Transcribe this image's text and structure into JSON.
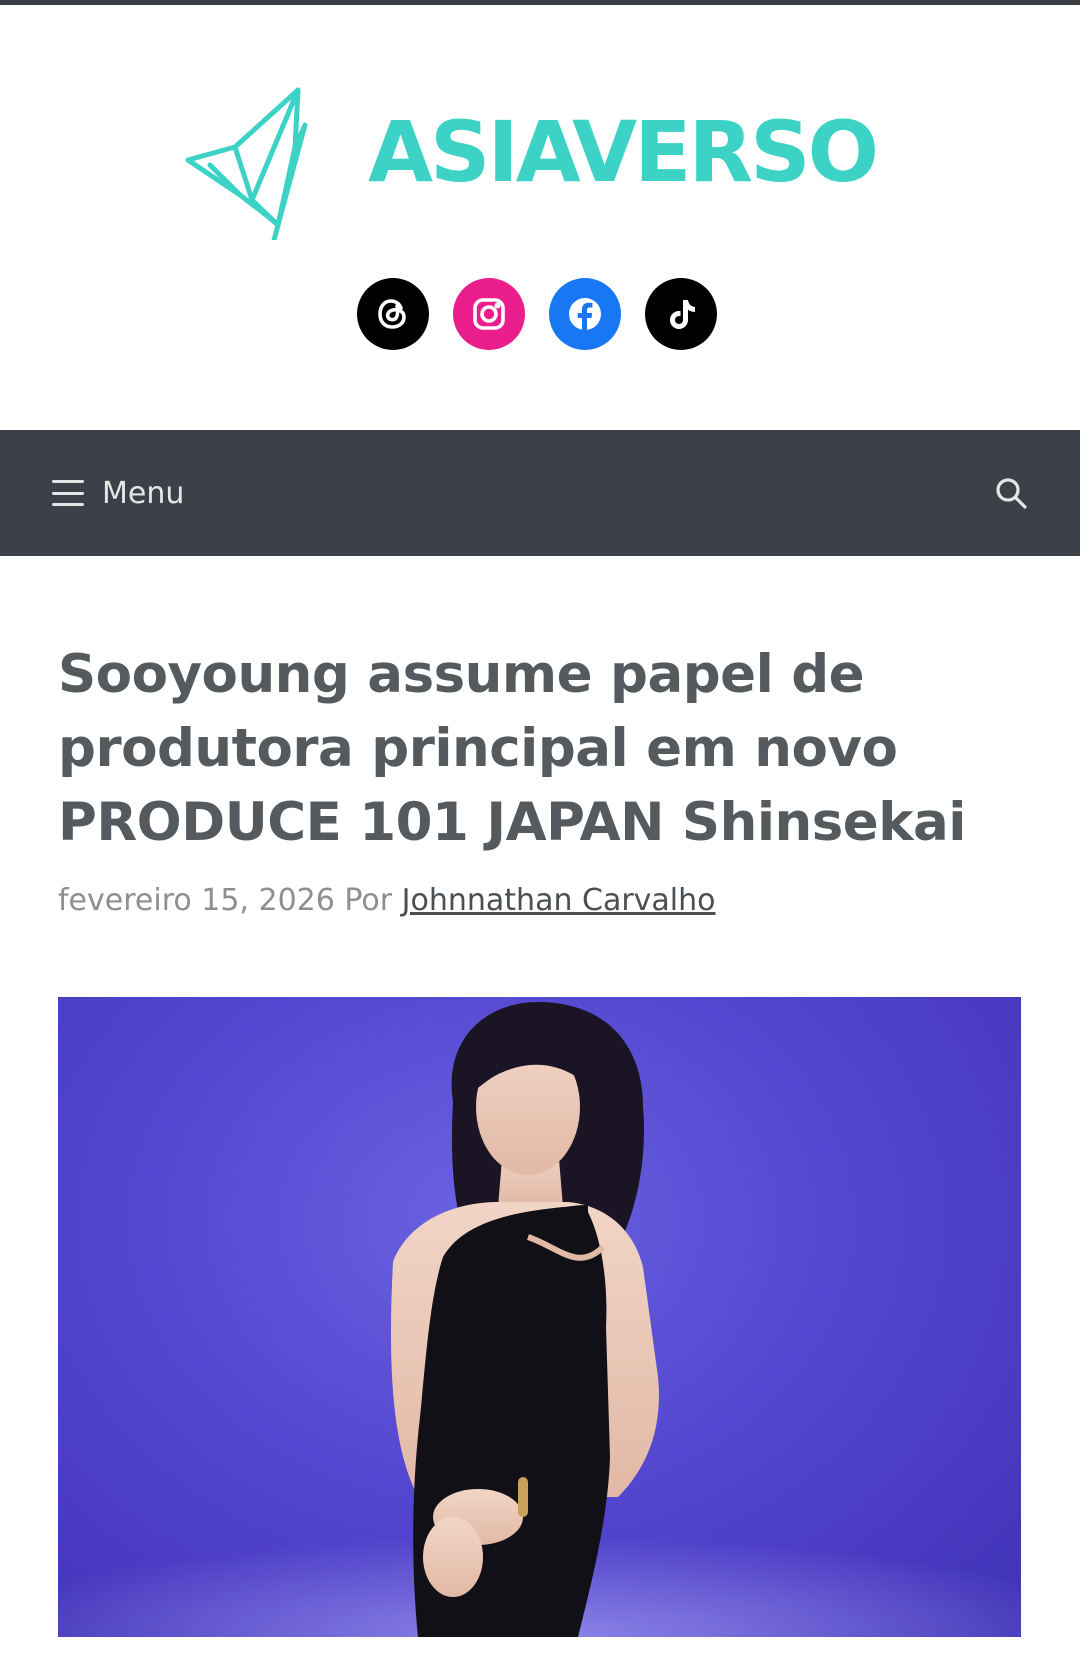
{
  "site": {
    "name": "ASIAVERSO",
    "brand_color": "#3cd3c6",
    "logo_icon": "origami-bird-icon"
  },
  "socials": [
    {
      "name": "threads",
      "icon": "threads-icon",
      "color": "#000000"
    },
    {
      "name": "instagram",
      "icon": "instagram-icon",
      "color": "#e91e8c"
    },
    {
      "name": "facebook",
      "icon": "facebook-icon",
      "color": "#1877f2"
    },
    {
      "name": "tiktok",
      "icon": "tiktok-icon",
      "color": "#000000"
    }
  ],
  "nav": {
    "menu_label": "Menu",
    "menu_icon": "hamburger-icon",
    "search_icon": "search-icon",
    "bar_color": "#3c4048"
  },
  "article": {
    "title": "Sooyoung assume papel de produtora principal em novo PRODUCE 101 JAPAN Shinsekai",
    "date": "fevereiro 15, 2026",
    "by_label": "Por",
    "author": "Johnnathan Carvalho",
    "image_background": "#5447d0"
  }
}
